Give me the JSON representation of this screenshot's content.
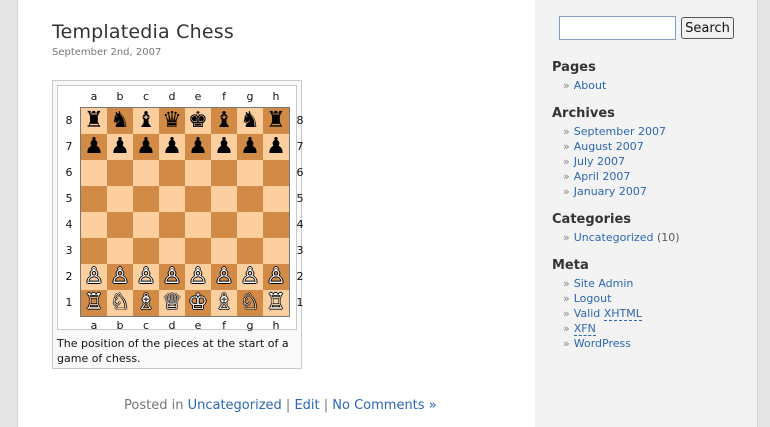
{
  "post": {
    "title": "Templatedia Chess",
    "date": "September 2nd, 2007",
    "caption": "The position of the pieces at the start of a game of chess.",
    "files": [
      "a",
      "b",
      "c",
      "d",
      "e",
      "f",
      "g",
      "h"
    ],
    "ranks": [
      "8",
      "7",
      "6",
      "5",
      "4",
      "3",
      "2",
      "1"
    ],
    "board": [
      [
        "♜",
        "♞",
        "♝",
        "♛",
        "♚",
        "♝",
        "♞",
        "♜"
      ],
      [
        "♟",
        "♟",
        "♟",
        "♟",
        "♟",
        "♟",
        "♟",
        "♟"
      ],
      [
        "",
        "",
        "",
        "",
        "",
        "",
        "",
        ""
      ],
      [
        "",
        "",
        "",
        "",
        "",
        "",
        "",
        ""
      ],
      [
        "",
        "",
        "",
        "",
        "",
        "",
        "",
        ""
      ],
      [
        "",
        "",
        "",
        "",
        "",
        "",
        "",
        ""
      ],
      [
        "♙",
        "♙",
        "♙",
        "♙",
        "♙",
        "♙",
        "♙",
        "♙"
      ],
      [
        "♖",
        "♘",
        "♗",
        "♕",
        "♔",
        "♗",
        "♘",
        "♖"
      ]
    ],
    "meta": {
      "posted_in": "Posted in",
      "category": "Uncategorized",
      "sep1": " | ",
      "edit": "Edit",
      "sep2": " | ",
      "comments": "No Comments »"
    }
  },
  "colors": {
    "light_square": "#fdcf9e",
    "dark_square": "#d28b47",
    "link": "#2b67b2"
  },
  "sidebar": {
    "search": {
      "value": "",
      "button": "Search"
    },
    "pages": {
      "heading": "Pages",
      "items": [
        "About"
      ]
    },
    "archives": {
      "heading": "Archives",
      "items": [
        "September 2007",
        "August 2007",
        "July 2007",
        "April 2007",
        "January 2007"
      ]
    },
    "categories": {
      "heading": "Categories",
      "items": [
        {
          "label": "Uncategorized",
          "count": "(10)"
        }
      ]
    },
    "meta": {
      "heading": "Meta",
      "site_admin": "Site Admin",
      "logout": "Logout",
      "valid": "Valid",
      "xhtml": "XHTML",
      "xfn": "XFN",
      "wordpress": "WordPress"
    }
  }
}
